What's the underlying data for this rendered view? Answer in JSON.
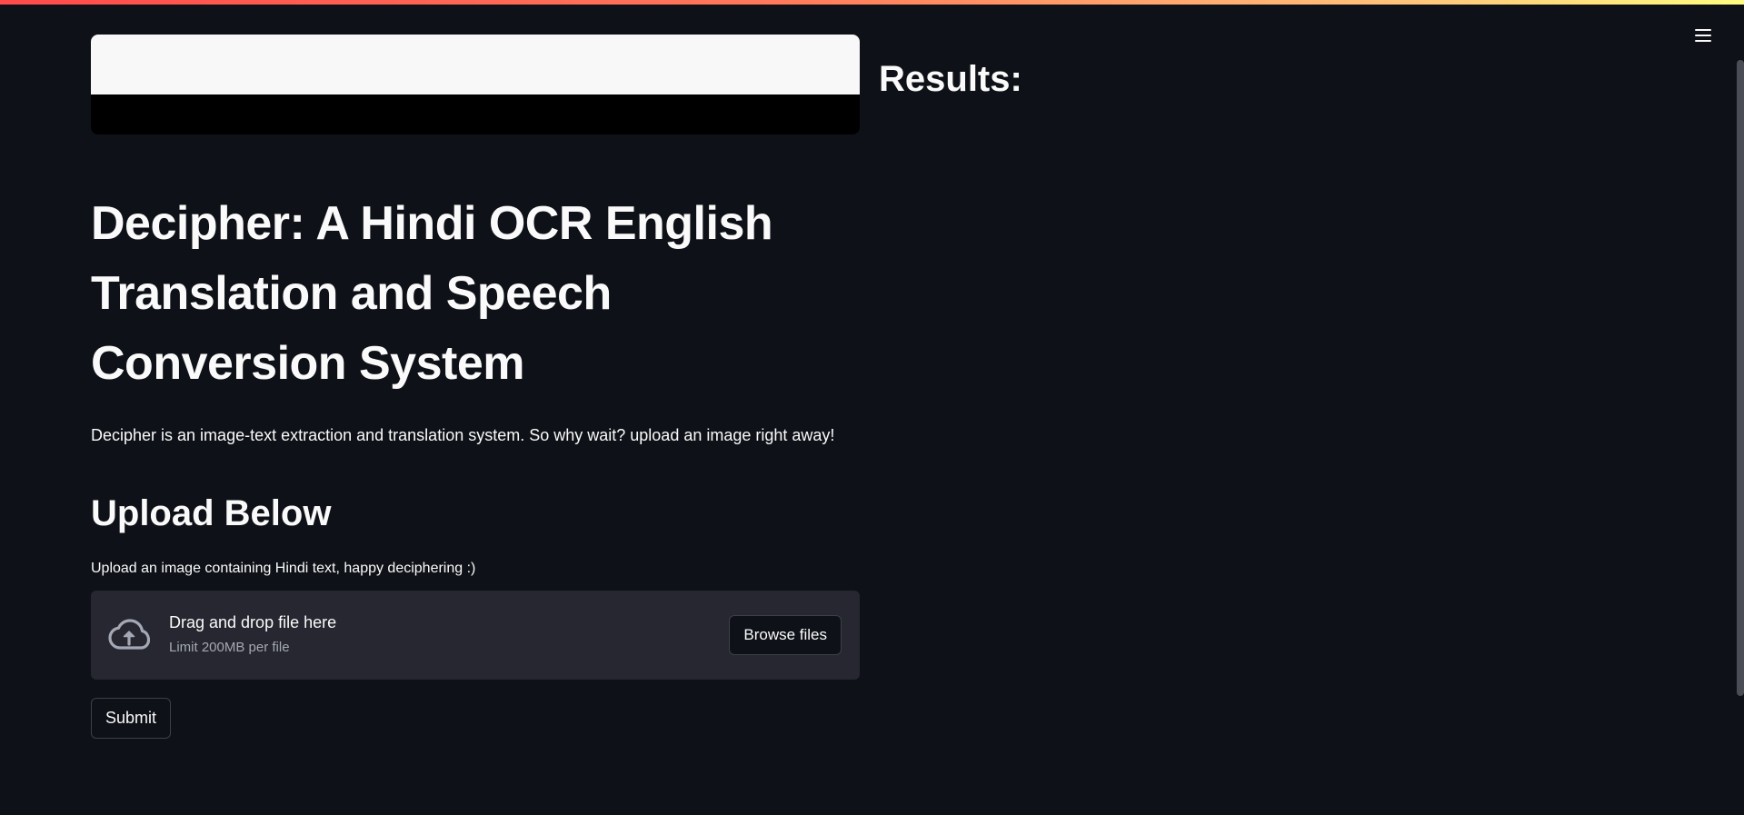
{
  "header": {
    "menu_icon": "hamburger-menu-icon"
  },
  "main": {
    "title": "Decipher: A Hindi OCR English Translation and Speech Conversion System",
    "description": "Decipher is an image-text extraction and translation system. So why wait? upload an image right away!",
    "upload_heading": "Upload Below",
    "uploader": {
      "label": "Upload an image containing Hindi text, happy deciphering :)",
      "icon": "cloud-upload-icon",
      "dropzone_title": "Drag and drop file here",
      "dropzone_limit": "Limit 200MB per file",
      "browse_label": "Browse files"
    },
    "submit_label": "Submit"
  },
  "results": {
    "heading": "Results:"
  },
  "colors": {
    "background": "#0e1117",
    "dropzone": "#262730",
    "text": "#fafafa",
    "muted_text": "#a3a8b4",
    "accent_gradient_start": "#ff4b4b",
    "accent_gradient_end": "#fffd80"
  }
}
